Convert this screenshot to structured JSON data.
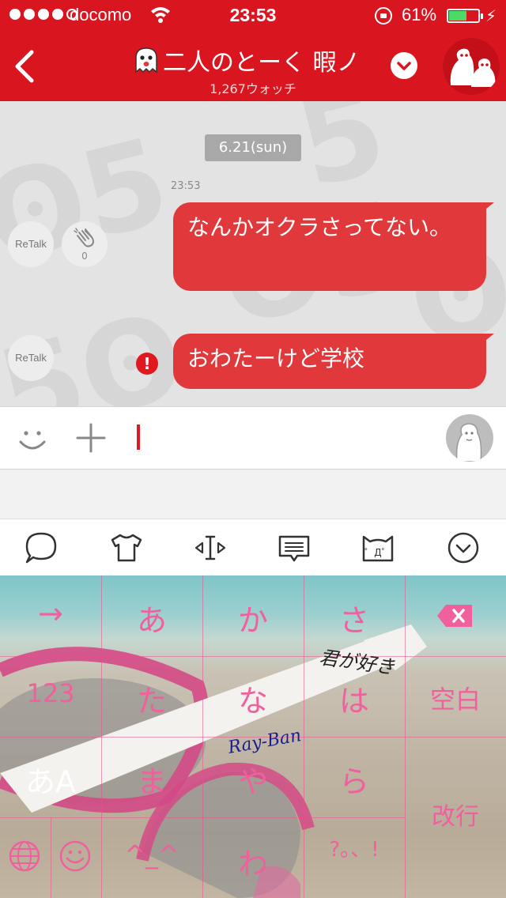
{
  "status_bar": {
    "carrier": "docomo",
    "time": "23:53",
    "battery_percent": "61%",
    "battery_level": 0.61
  },
  "header": {
    "title": "二人のとーく 暇ノ",
    "subtitle": "1,267ウォッチ"
  },
  "chat": {
    "date": "6.21(sun)",
    "timestamp": "23:53",
    "retalk_label": "ReTalk",
    "clap_count": "0",
    "messages": [
      {
        "text": "なんかオクラさってない。",
        "status": "sent"
      },
      {
        "text": "おわたーけど学校",
        "status": "error"
      }
    ],
    "error_mark": "!"
  },
  "input": {
    "value": "",
    "placeholder": ""
  },
  "keyboard": {
    "rows": [
      [
        "→",
        "あ",
        "か",
        "さ"
      ],
      [
        "123",
        "た",
        "な",
        "は"
      ],
      [
        "あA",
        "ま",
        "や",
        "ら"
      ],
      [
        "",
        "^_^",
        "わ",
        "?。、!"
      ]
    ],
    "space_label": "空白",
    "return_label": "改行",
    "image_text_1": "君が好き",
    "image_text_2": "Ray-Ban"
  },
  "colors": {
    "header_red": "#d9161f",
    "bubble_red": "#e0383b",
    "key_pink": "#f0609c"
  }
}
